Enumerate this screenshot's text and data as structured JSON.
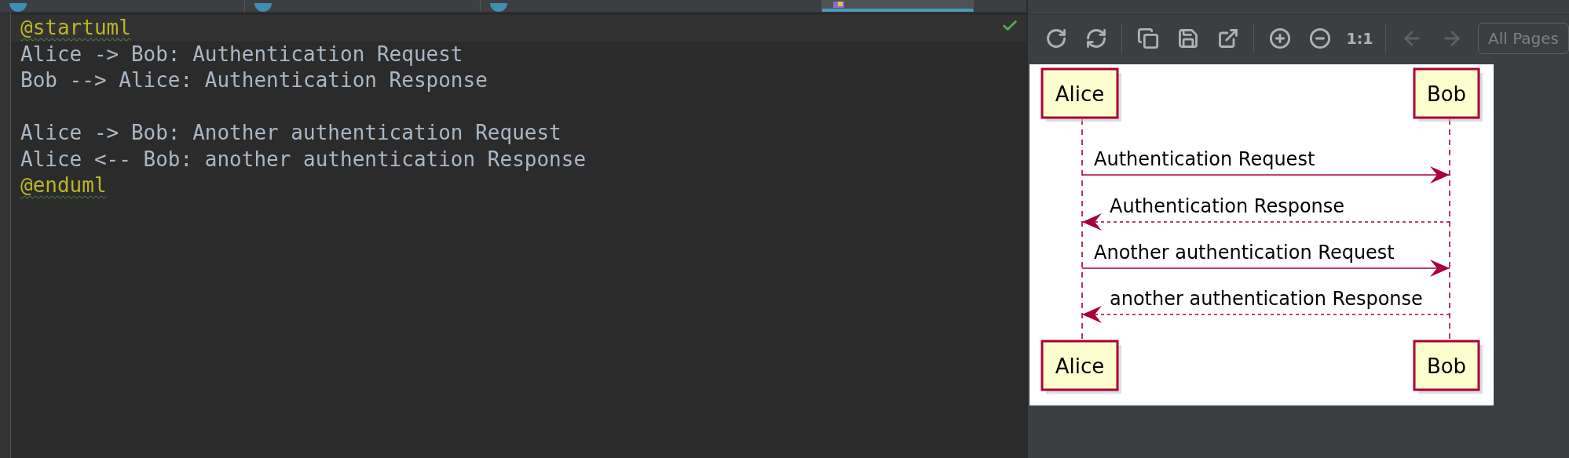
{
  "editor_tabs": [
    {
      "kind": "java",
      "selected": false
    },
    {
      "kind": "java",
      "selected": false
    },
    {
      "kind": "java",
      "selected": false
    },
    {
      "kind": "plantuml",
      "selected": true
    }
  ],
  "editor": {
    "lines": [
      {
        "kind": "directive",
        "text": "@startuml"
      },
      {
        "kind": "code",
        "text": "Alice -> Bob: Authentication Request"
      },
      {
        "kind": "code",
        "text": "Bob --> Alice: Authentication Response"
      },
      {
        "kind": "blank"
      },
      {
        "kind": "code",
        "text": "Alice -> Bob: Another authentication Request"
      },
      {
        "kind": "code",
        "text": "Alice <-- Bob: another authentication Response"
      },
      {
        "kind": "directive",
        "text": "@enduml"
      }
    ]
  },
  "plantuml_toolbar": {
    "items": [
      {
        "kind": "reload",
        "disabled": false
      },
      {
        "kind": "refresh",
        "disabled": false
      },
      {
        "kind": "separator"
      },
      {
        "kind": "copy",
        "disabled": false
      },
      {
        "kind": "save",
        "disabled": false
      },
      {
        "kind": "export",
        "disabled": false
      },
      {
        "kind": "separator"
      },
      {
        "kind": "zoom_in",
        "disabled": false
      },
      {
        "kind": "zoom_out",
        "disabled": false
      },
      {
        "kind": "actual_size",
        "label": "1:1",
        "disabled": false
      },
      {
        "kind": "separator"
      },
      {
        "kind": "previous",
        "disabled": true
      },
      {
        "kind": "next",
        "disabled": true
      }
    ],
    "page_select": {
      "value": "All Pages"
    }
  },
  "diagram": {
    "participants_top": [
      "Alice",
      "Bob"
    ],
    "messages": [
      {
        "kind": "request",
        "text": "Authentication Request"
      },
      {
        "kind": "response",
        "text": "Authentication Response"
      },
      {
        "kind": "request",
        "text": "Another authentication Request"
      },
      {
        "kind": "response",
        "text": "another authentication Response"
      }
    ],
    "participants_bottom": [
      "Alice",
      "Bob"
    ]
  }
}
